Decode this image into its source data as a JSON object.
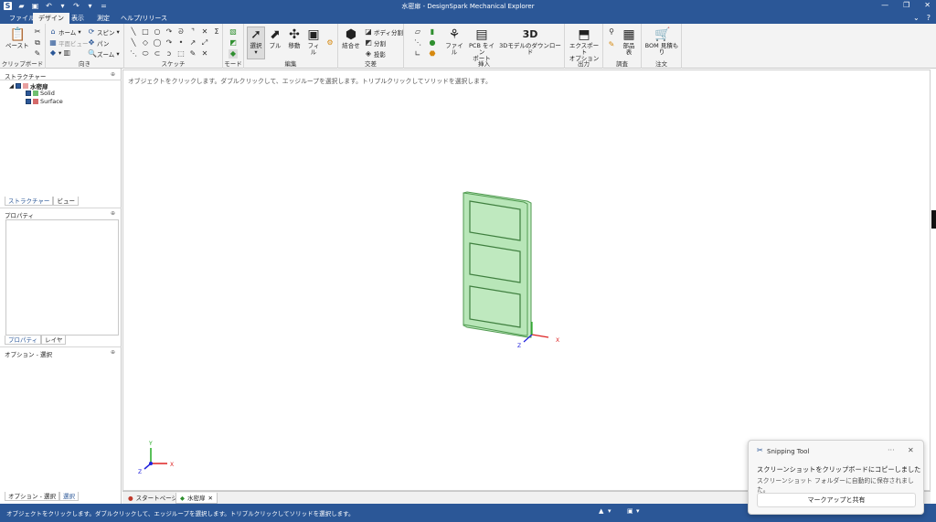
{
  "window": {
    "title": "水密扉 - DesignSpark Mechanical Explorer",
    "controls": [
      "—",
      "❐",
      "✕"
    ]
  },
  "tabs": [
    {
      "label": "ファイル",
      "active": false
    },
    {
      "label": "デザイン",
      "active": true
    },
    {
      "label": "表示",
      "active": false
    },
    {
      "label": "測定",
      "active": false
    },
    {
      "label": "ヘルプ/リリース",
      "active": false
    }
  ],
  "ribbon": {
    "clipboard": {
      "paste": "ペースト",
      "label": "クリップボード"
    },
    "orient": {
      "home": "ホーム",
      "plane_view": "平面ビュー",
      "spin": "スピン",
      "pan": "パン",
      "zoom": "ズーム",
      "label": "向き"
    },
    "sketch": {
      "label": "スケッチ"
    },
    "mode": {
      "label": "モード"
    },
    "edit": {
      "select": "選択",
      "pull": "プル",
      "move": "移動",
      "fill": "フィル",
      "label": "編集"
    },
    "intersect": {
      "combine": "結合せ",
      "split_body": "ボディ分割",
      "split": "分割",
      "project": "投影",
      "label": "交差"
    },
    "insert": {
      "file": "ファイル",
      "pcb_import_1": "PCB をイン",
      "pcb_import_2": "ポート",
      "model_3d_icon": "3D",
      "model_download": "3Dモデルのダウンロード",
      "label": "挿入"
    },
    "output": {
      "export_1": "エクスポート",
      "export_2": "オプション",
      "label": "出力"
    },
    "inspect": {
      "parts_1": "部品",
      "parts_2": "表",
      "label": "調査"
    },
    "order": {
      "bom_1": "BOM 見積も",
      "bom_2": "り",
      "label": "注文"
    }
  },
  "structure": {
    "title": "ストラクチャー",
    "root": "水密扉",
    "children": [
      "Solid",
      "Surface"
    ],
    "tab_structure": "ストラクチャー",
    "tab_view": "ビュー"
  },
  "properties": {
    "title": "プロパティ",
    "tab_props": "プロパティ",
    "tab_layers": "レイヤ"
  },
  "options": {
    "title": "オプション - 選択",
    "tab_options": "オプション - 選択",
    "tab_select": "選択"
  },
  "viewport": {
    "hint": "オブジェクトをクリックします。ダブルクリックして、エッジループを選択します。トリプルクリックしてソリッドを選択します。",
    "model_color": "#b8e6b8",
    "axis_x": "X",
    "axis_y": "Y",
    "axis_z": "Z"
  },
  "doc_tabs": [
    {
      "label": "スタートページ",
      "active": false
    },
    {
      "label": "水密扉",
      "active": true
    }
  ],
  "statusbar": {
    "text": "オブジェクトをクリックします。ダブルクリックして、エッジループを選択します。トリプルクリックしてソリッドを選択します。"
  },
  "toast": {
    "app": "Snipping Tool",
    "more": "···",
    "close": "✕",
    "title": "スクリーンショットをクリップボードにコピーしました",
    "subtitle": "スクリーンショット フォルダーに自動的に保存されました。",
    "button": "マークアップと共有"
  }
}
